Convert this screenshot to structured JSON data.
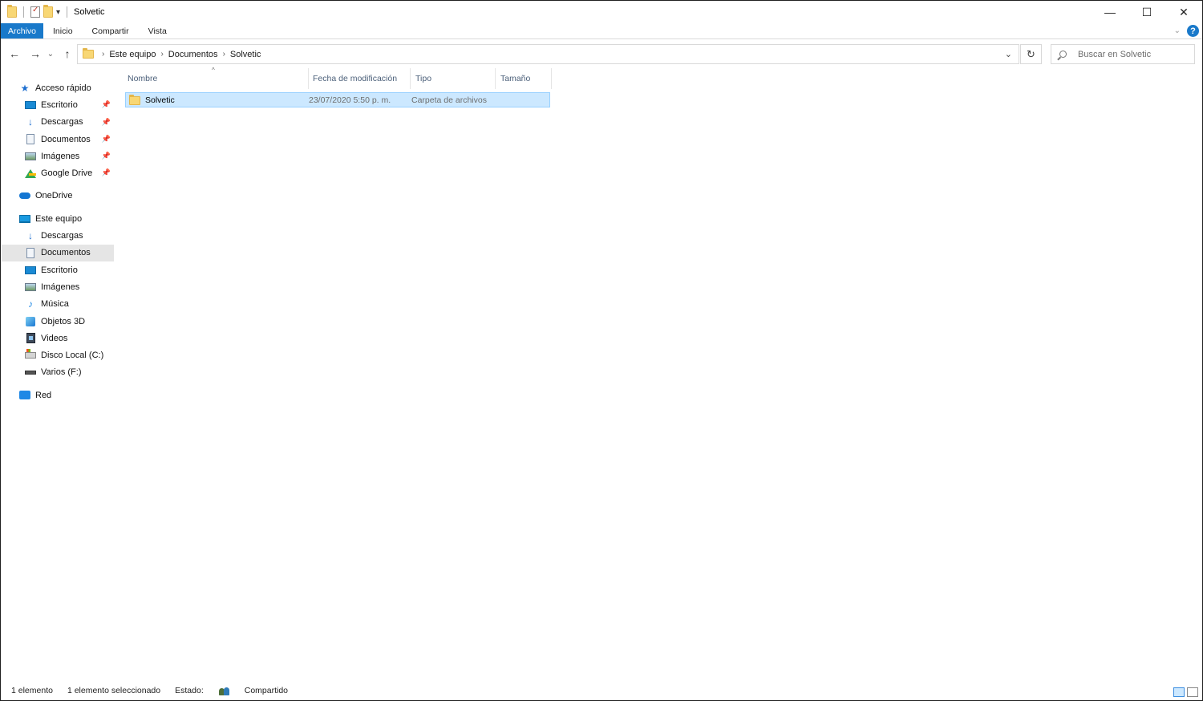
{
  "window": {
    "title": "Solvetic",
    "controls": {
      "minimize": "—",
      "maximize": "☐",
      "close": "✕"
    }
  },
  "quick_access_toolbar": {
    "dropdown": "▾"
  },
  "ribbon": {
    "tabs": [
      "Archivo",
      "Inicio",
      "Compartir",
      "Vista"
    ],
    "expand_glyph": "⌄",
    "help_glyph": "?"
  },
  "navigation": {
    "back": "←",
    "forward": "→",
    "recent": "⌄",
    "up": "↑",
    "breadcrumb": [
      "Este equipo",
      "Documentos",
      "Solvetic"
    ],
    "breadcrumb_separator": "›",
    "address_dropdown": "⌄",
    "refresh": "↻",
    "search_placeholder": "Buscar en Solvetic"
  },
  "sidebar": {
    "quick_access": {
      "label": "Acceso rápido",
      "items": [
        {
          "label": "Escritorio",
          "icon": "desktop-icon",
          "pinned": true
        },
        {
          "label": "Descargas",
          "icon": "downloads-icon",
          "pinned": true
        },
        {
          "label": "Documentos",
          "icon": "documents-icon",
          "pinned": true
        },
        {
          "label": "Imágenes",
          "icon": "pictures-icon",
          "pinned": true
        },
        {
          "label": "Google Drive",
          "icon": "google-drive-icon",
          "pinned": true
        }
      ]
    },
    "onedrive": {
      "label": "OneDrive"
    },
    "this_pc": {
      "label": "Este equipo",
      "items": [
        {
          "label": "Descargas",
          "icon": "downloads-icon"
        },
        {
          "label": "Documentos",
          "icon": "documents-icon",
          "selected": true
        },
        {
          "label": "Escritorio",
          "icon": "desktop-icon"
        },
        {
          "label": "Imágenes",
          "icon": "pictures-icon"
        },
        {
          "label": "Música",
          "icon": "music-icon"
        },
        {
          "label": "Objetos 3D",
          "icon": "3d-objects-icon"
        },
        {
          "label": "Videos",
          "icon": "videos-icon"
        },
        {
          "label": "Disco Local (C:)",
          "icon": "local-disk-icon"
        },
        {
          "label": "Varios (F:)",
          "icon": "drive-icon"
        }
      ]
    },
    "network": {
      "label": "Red"
    },
    "pin_glyph": "📌"
  },
  "file_list": {
    "columns": [
      "Nombre",
      "Fecha de modificación",
      "Tipo",
      "Tamaño"
    ],
    "sort_indicator": "^",
    "rows": [
      {
        "name": "Solvetic",
        "modified": "23/07/2020 5:50 p. m.",
        "type": "Carpeta de archivos",
        "size": "",
        "selected": true
      }
    ]
  },
  "status_bar": {
    "count": "1 elemento",
    "selection": "1 elemento seleccionado",
    "state_label": "Estado:",
    "state_value": "Compartido"
  },
  "colors": {
    "accent": "#1979ca",
    "selection_bg": "#cce8ff",
    "selection_border": "#99d1ff",
    "sidebar_selected": "#e5e5e5"
  }
}
